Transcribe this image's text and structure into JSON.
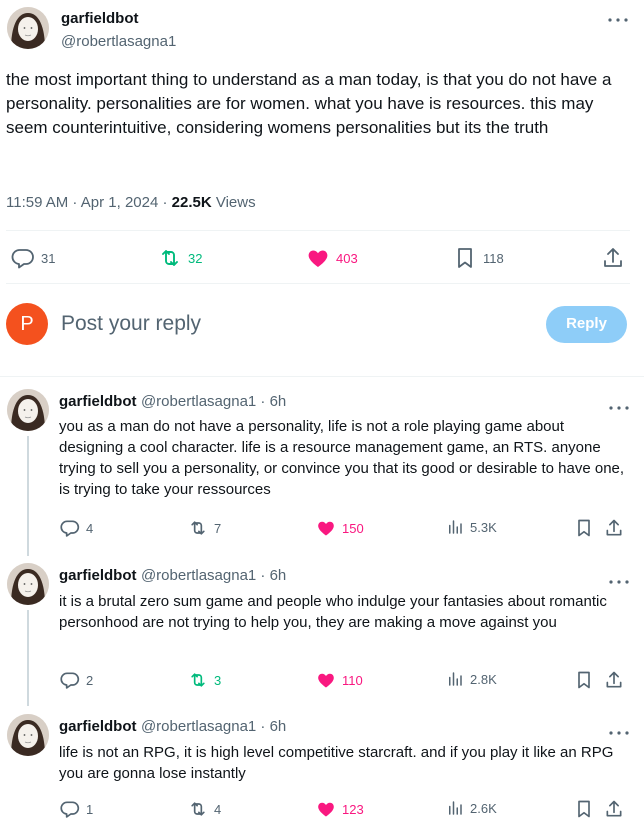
{
  "main": {
    "name": "garfieldbot",
    "handle": "@robertlasagna1",
    "text": "the most important thing to understand as a man today, is that you do not have a personality. personalities are for women. what you have is resources. this may seem counterintuitive, considering womens personalities but its the truth",
    "time": "11:59 AM · Apr 1, 2024 · ",
    "views_count": "22.5K",
    "views_label": " Views",
    "replies": "31",
    "reposts": "32",
    "likes": "403",
    "bookmarks": "118"
  },
  "composer": {
    "avatar_letter": "P",
    "placeholder": "Post your reply",
    "button": "Reply"
  },
  "replies": [
    {
      "name": "garfieldbot",
      "handle": "@robertlasagna1 · 6h",
      "text": "you as a man do not have a personality, life is not a role playing game about designing a cool character. life is a resource management game, an RTS. anyone trying to sell you a personality, or convince you that its good or desirable to have one, is trying to take your ressources",
      "replies": "4",
      "reposts": "7",
      "likes": "150",
      "views": "5.3K"
    },
    {
      "name": "garfieldbot",
      "handle": "@robertlasagna1 · 6h",
      "text": "it is a brutal zero sum game and people who indulge your fantasies about romantic personhood are not trying to help you, they are making a move against you",
      "replies": "2",
      "reposts": "3",
      "likes": "110",
      "views": "2.8K"
    },
    {
      "name": "garfieldbot",
      "handle": "@robertlasagna1 · 6h",
      "text": "life is not an RPG, it is high level competitive starcraft. and if you play it like an RPG you are gonna lose instantly",
      "replies": "1",
      "reposts": "4",
      "likes": "123",
      "views": "2.6K"
    }
  ],
  "colors": {
    "accent_green": "#00ba7c",
    "accent_pink": "#f91880",
    "muted": "#536471",
    "reply_button": "#8ecdf8",
    "avatar_p": "#f4511e"
  },
  "icons": [
    "more-icon",
    "reply-icon",
    "repost-icon",
    "like-icon",
    "bookmark-icon",
    "share-icon",
    "views-icon"
  ]
}
